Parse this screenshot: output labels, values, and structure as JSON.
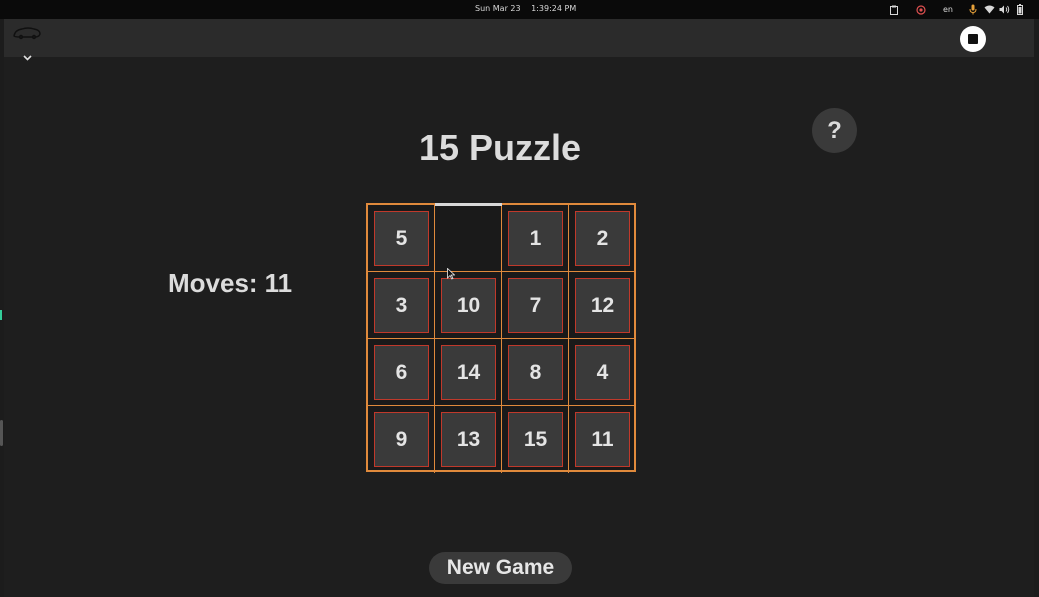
{
  "system_bar": {
    "date": "Sun Mar 23",
    "time": "1:39:24 PM",
    "language": "en",
    "icons": [
      "clipboard-icon",
      "screen-record-icon",
      "microphone-icon",
      "wifi-icon",
      "volume-icon",
      "battery-icon"
    ]
  },
  "header": {
    "app_icon": "app-logo-icon",
    "menu_icon": "chevron-down-icon",
    "stop_icon": "stop-icon"
  },
  "game": {
    "title": "15 Puzzle",
    "help_label": "?",
    "moves_label": "Moves:",
    "moves_value": "11",
    "new_game_label": "New Game",
    "board": [
      [
        "5",
        "",
        "1",
        "2"
      ],
      [
        "3",
        "10",
        "7",
        "12"
      ],
      [
        "6",
        "14",
        "8",
        "4"
      ],
      [
        "9",
        "13",
        "15",
        "11"
      ]
    ]
  },
  "colors": {
    "background": "#1e1e1e",
    "tile_fill": "#3a3a3a",
    "board_border": "#e08a3c",
    "tile_border": "#c0392b",
    "text": "#dcdcdc"
  }
}
